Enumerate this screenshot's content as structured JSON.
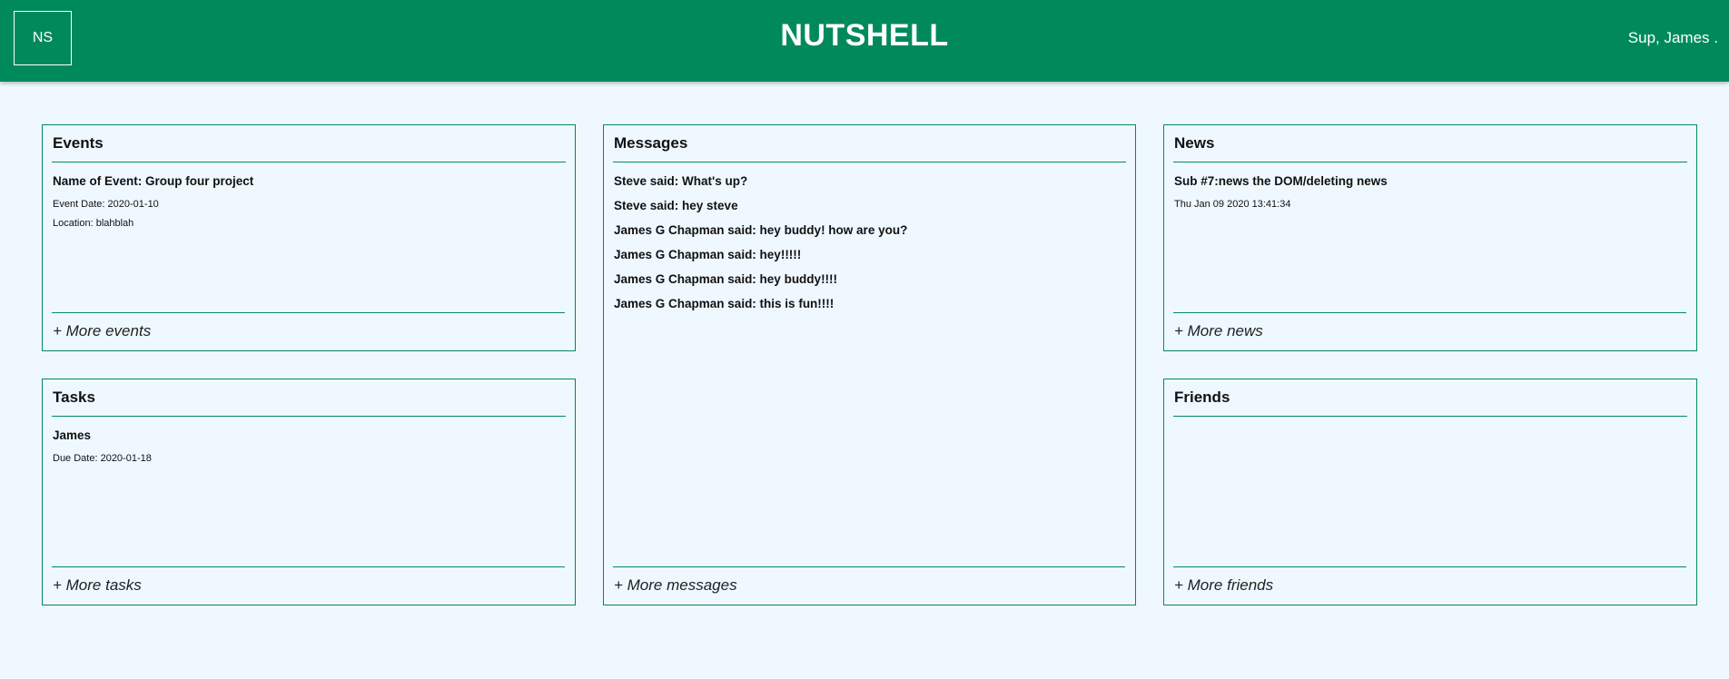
{
  "header": {
    "logo": "NS",
    "title": "NUTSHELL",
    "greeting": "Sup, James ."
  },
  "events": {
    "title": "Events",
    "item": {
      "name": "Name of Event: Group four project",
      "date": "Event Date: 2020-01-10",
      "location": "Location: blahblah"
    },
    "more": "+ More events"
  },
  "tasks": {
    "title": "Tasks",
    "item": {
      "name": "James",
      "due": "Due Date: 2020-01-18"
    },
    "more": "+ More tasks"
  },
  "messages": {
    "title": "Messages",
    "items": [
      "Steve said: What's up?",
      "Steve said: hey steve",
      "James G Chapman said: hey buddy! how are you?",
      "James G Chapman said: hey!!!!!",
      "James G Chapman said: hey buddy!!!!",
      "James G Chapman said: this is fun!!!!"
    ],
    "more": "+ More messages"
  },
  "news": {
    "title": "News",
    "item": {
      "headline": "Sub #7:news the DOM/deleting news",
      "timestamp": "Thu Jan 09 2020 13:41:34"
    },
    "more": "+ More news"
  },
  "friends": {
    "title": "Friends",
    "more": "+ More friends"
  },
  "colors": {
    "header_bg": "#008a5c",
    "page_bg": "#eff8ff",
    "border": "#008a5c"
  }
}
